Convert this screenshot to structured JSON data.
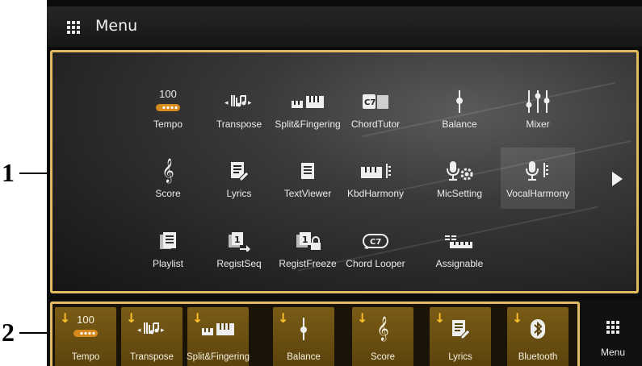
{
  "header": {
    "title": "Menu",
    "icon": "grid-icon"
  },
  "callouts": [
    "1",
    "2"
  ],
  "menu_items": [
    {
      "label": "Tempo",
      "value": "100",
      "icon": "tempo-icon"
    },
    {
      "label": "Transpose",
      "icon": "transpose-icon"
    },
    {
      "label": "Split&Fingering",
      "icon": "split-fingering-icon"
    },
    {
      "label": "ChordTutor",
      "icon": "chord-tutor-icon"
    },
    {
      "label": "Balance",
      "icon": "balance-icon"
    },
    {
      "label": "Mixer",
      "icon": "mixer-icon"
    },
    {
      "label": "Score",
      "icon": "score-icon"
    },
    {
      "label": "Lyrics",
      "icon": "lyrics-icon"
    },
    {
      "label": "TextViewer",
      "icon": "text-viewer-icon"
    },
    {
      "label": "KbdHarmony",
      "icon": "kbd-harmony-icon"
    },
    {
      "label": "MicSetting",
      "icon": "mic-setting-icon"
    },
    {
      "label": "VocalHarmony",
      "icon": "vocal-harmony-icon"
    },
    {
      "label": "Playlist",
      "icon": "playlist-icon"
    },
    {
      "label": "RegistSeq",
      "icon": "regist-seq-icon"
    },
    {
      "label": "RegistFreeze",
      "icon": "regist-freeze-icon"
    },
    {
      "label": "Chord Looper",
      "icon": "chord-looper-icon"
    },
    {
      "label": "Assignable",
      "icon": "assignable-icon"
    }
  ],
  "shortcuts": [
    {
      "label": "Tempo",
      "value": "100",
      "icon": "tempo-icon"
    },
    {
      "label": "Transpose",
      "icon": "transpose-icon"
    },
    {
      "label": "Split&Fingering",
      "icon": "split-fingering-icon"
    },
    {
      "label": "Balance",
      "icon": "balance-icon"
    },
    {
      "label": "Score",
      "icon": "score-icon"
    },
    {
      "label": "Lyrics",
      "icon": "lyrics-icon"
    },
    {
      "label": "Bluetooth",
      "icon": "bluetooth-icon"
    }
  ],
  "shortcut_arrow": "↓",
  "menu_button": {
    "label": "Menu",
    "icon": "grid-icon"
  },
  "colors": {
    "accent_border": "#e2bb60",
    "shortcut_bg": "#6b4f12",
    "arrow": "#ffc22a"
  }
}
